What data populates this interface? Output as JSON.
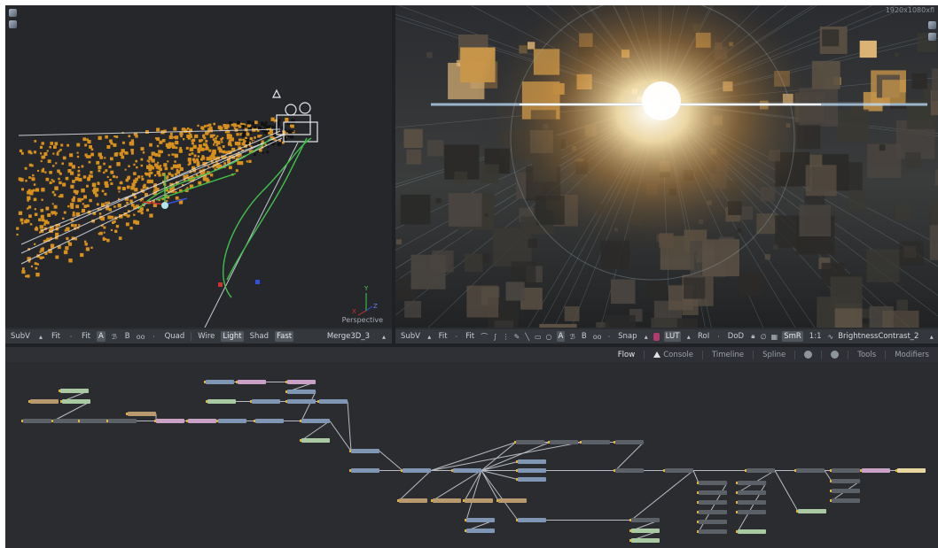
{
  "viewer_left": {
    "label_view": "Perspective",
    "axis_x": "X",
    "axis_y": "Y",
    "axis_z": "Z"
  },
  "viewer_right": {
    "resolution": "1920x1080xfl"
  },
  "toolbar_left": {
    "subv": "SubV",
    "fit1": "Fit",
    "fit2": "Fit",
    "a": "A",
    "b": "B",
    "quad": "Quad",
    "wire": "Wire",
    "light": "Light",
    "shad": "Shad",
    "fast": "Fast",
    "node_name": "Merge3D_3"
  },
  "toolbar_right": {
    "subv": "SubV",
    "fit1": "Fit",
    "fit2": "Fit",
    "a": "A",
    "b": "B",
    "snap": "Snap",
    "lut": "LUT",
    "roi": "RoI",
    "dod": "DoD",
    "smr": "SmR",
    "ratio": "1:1",
    "node_name": "BrightnessContrast_2"
  },
  "tabs": {
    "flow": "Flow",
    "console": "Console",
    "timeline": "Timeline",
    "spline": "Spline",
    "tools": "Tools",
    "modifiers": "Modifiers"
  },
  "colors": {
    "particle": "#d8901c",
    "path_green": "#3fbf4a",
    "node_blue": "#7f97b4",
    "node_pink": "#c9a0c6",
    "node_tan": "#b99a6e",
    "node_green": "#a9c9a2",
    "node_dark": "#5c6168",
    "node_output": "#e8d8a0",
    "link": "#c8ccd2"
  }
}
